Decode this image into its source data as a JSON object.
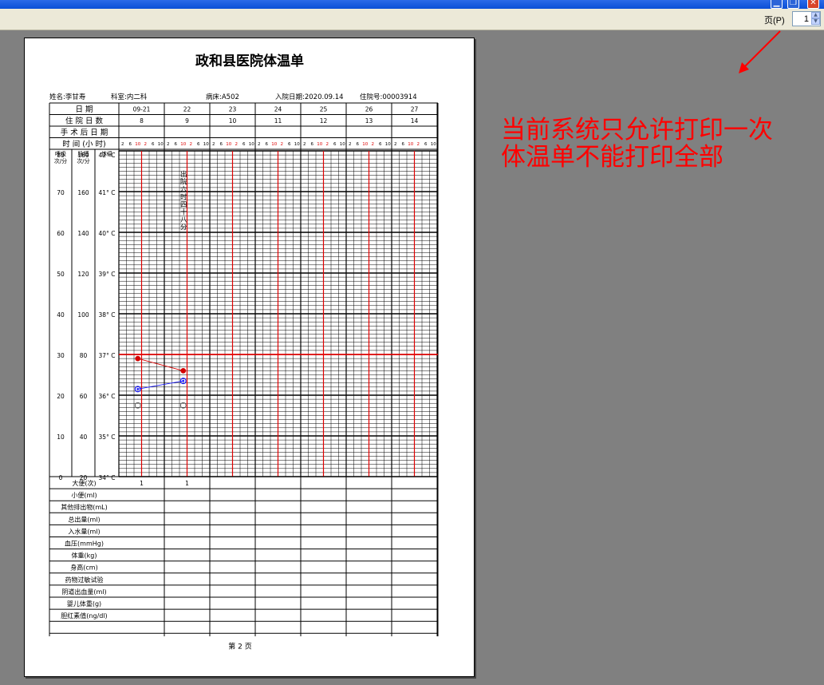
{
  "window": {
    "min_glyph": "▁",
    "max_glyph": "❐",
    "close_glyph": "✕"
  },
  "toolbar": {
    "page_label": "页(P)",
    "page_value": "1",
    "spin_up": "▲",
    "spin_down": "▼"
  },
  "sheet": {
    "title": "政和县医院体温单",
    "name_label": "姓名:",
    "name": "李甘寿",
    "dept_label": "科室:",
    "dept": "内二科",
    "bed_label": "病床:",
    "bed": "A502",
    "admit_label": "入院日期:",
    "admit_date": "2020.09.14",
    "inpatient_label": "住院号:",
    "inpatient_no": "00003914",
    "row_date": "日      期",
    "row_days": "住  院  日  数",
    "row_postop": "手 术 后 日 期",
    "row_time": "时  间  (小 时)",
    "dates": [
      "09-21",
      "22",
      "23",
      "24",
      "25",
      "26",
      "27"
    ],
    "days": [
      "8",
      "9",
      "10",
      "11",
      "12",
      "13",
      "14"
    ],
    "hours": [
      "2",
      "6",
      "10",
      "2",
      "6",
      "10"
    ],
    "col_resp": [
      "呼吸",
      "次/分"
    ],
    "col_pulse": [
      "脉搏",
      "次/分"
    ],
    "col_temp": [
      "体温"
    ],
    "resp_ticks": [
      "80",
      "70",
      "60",
      "50",
      "40",
      "30",
      "20",
      "10",
      "0"
    ],
    "pulse_ticks": [
      "180",
      "160",
      "140",
      "120",
      "100",
      "80",
      "60",
      "40",
      "20"
    ],
    "temp_ticks": [
      "42° C",
      "41° C",
      "40° C",
      "39° C",
      "38° C",
      "37° C",
      "36° C",
      "35° C",
      "34° C"
    ],
    "vertical_note": [
      "出",
      "院",
      "六",
      "时",
      "四",
      "十",
      "八",
      "分"
    ],
    "bottom_rows": [
      {
        "label": "大便(次)",
        "values": [
          "1",
          "1",
          "",
          "",
          "",
          "",
          ""
        ]
      },
      {
        "label": "小便(ml)",
        "values": []
      },
      {
        "label": "其他排出物(mL)",
        "values": []
      },
      {
        "label": "总出量(ml)",
        "values": []
      },
      {
        "label": "入水量(ml)",
        "values": []
      },
      {
        "label": "血压(mmHg)",
        "values": []
      },
      {
        "label": "体重(kg)",
        "values": []
      },
      {
        "label": "身高(cm)",
        "values": []
      },
      {
        "label": "药物过敏试验",
        "values": []
      },
      {
        "label": "阴道出血量(ml)",
        "values": []
      },
      {
        "label": "婴儿体重(g)",
        "values": []
      },
      {
        "label": "胆红素值(ng/dl)",
        "values": []
      },
      {
        "label": "",
        "values": []
      }
    ],
    "footer": "第  2  页"
  },
  "chart_data": {
    "type": "line",
    "title": "政和县医院体温单",
    "x_categories": [
      "09-21 2",
      "09-21 6",
      "09-21 10",
      "09-21 2",
      "09-21 6",
      "09-21 10",
      "22 2",
      "22 6",
      "22 10",
      "22 2",
      "22 6",
      "22 10"
    ],
    "y_axes": {
      "temperature_c": [
        34,
        42
      ],
      "pulse_per_min": [
        20,
        180
      ],
      "respiration_per_min": [
        0,
        80
      ]
    },
    "series": [
      {
        "axis": "temperature_c",
        "color": "#d40000",
        "marker": "filled-dot",
        "points": [
          {
            "day": 0,
            "slot": 2,
            "y": 36.9
          },
          {
            "day": 1,
            "slot": 2,
            "y": 36.6
          }
        ]
      },
      {
        "axis": "pulse_per_min",
        "color": "#1a1aff",
        "marker": "ring-dot",
        "points": [
          {
            "day": 0,
            "slot": 2,
            "y": 63
          },
          {
            "day": 1,
            "slot": 2,
            "y": 67
          }
        ]
      },
      {
        "axis": "pulse_per_min",
        "color": "#555555",
        "marker": "open-circle",
        "points": [
          {
            "day": 0,
            "slot": 2,
            "y": 55
          },
          {
            "day": 1,
            "slot": 2,
            "y": 55
          }
        ]
      }
    ],
    "reference_line": {
      "axis": "temperature_c",
      "y": 37,
      "color": "#ff0000"
    },
    "grid": true
  },
  "annotation": {
    "lines": [
      "当前系统只允许打印一次",
      "体温单不能打印全部"
    ],
    "color": "#ff0000"
  }
}
